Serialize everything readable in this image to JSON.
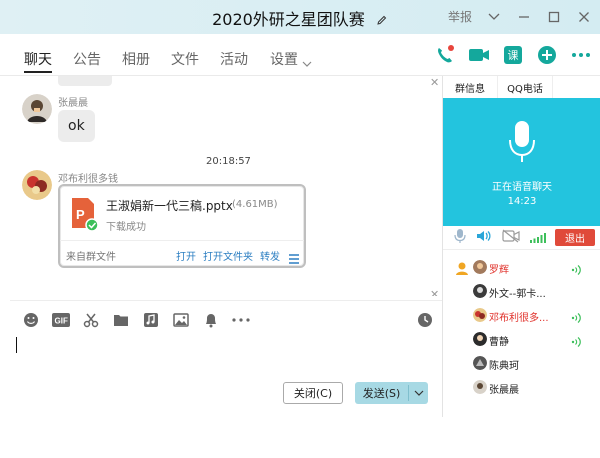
{
  "window": {
    "title": "2020外研之星团队赛"
  },
  "titlebar": {
    "report": "举报"
  },
  "tabs": [
    {
      "label": "聊天"
    },
    {
      "label": "公告"
    },
    {
      "label": "相册"
    },
    {
      "label": "文件"
    },
    {
      "label": "活动"
    },
    {
      "label": "设置"
    }
  ],
  "header_actions": {
    "ke_label": "课"
  },
  "chat": {
    "messages": [
      {
        "sender": "张晨晨",
        "text": "ok"
      }
    ],
    "timestamp": "20:18:57",
    "file_message": {
      "sender": "邓布利很多钱",
      "file_name": "王淑娟新一代三稿.pptx",
      "file_size": "(4.61MB)",
      "status": "下载成功",
      "source": "来自群文件",
      "actions": [
        "打开",
        "打开文件夹",
        "转发"
      ]
    }
  },
  "compose": {
    "close_button": "关闭(C)",
    "send_button": "发送(S)"
  },
  "right_panel": {
    "tabs": [
      "群信息",
      "QQ电话"
    ],
    "voice_status": "正在语音聊天",
    "voice_duration": "14:23",
    "exit_button": "退出",
    "members": [
      {
        "name": "罗辉",
        "highlight": true,
        "admin": true,
        "speaking": true
      },
      {
        "name": "外文--郭卡...",
        "highlight": false,
        "admin": false,
        "speaking": false
      },
      {
        "name": "邓布利很多...",
        "highlight": true,
        "admin": false,
        "speaking": true
      },
      {
        "name": "曹静",
        "highlight": false,
        "admin": false,
        "speaking": true
      },
      {
        "name": "陈典珂",
        "highlight": false,
        "admin": false,
        "speaking": false
      },
      {
        "name": "张晨晨",
        "highlight": false,
        "admin": false,
        "speaking": false
      }
    ]
  },
  "colors": {
    "accent_teal": "#14a89c",
    "voice_blue": "#23c4de",
    "exit_red": "#e04a3a",
    "send_blue": "#a7d9e4",
    "link_blue": "#2d7fc2"
  }
}
